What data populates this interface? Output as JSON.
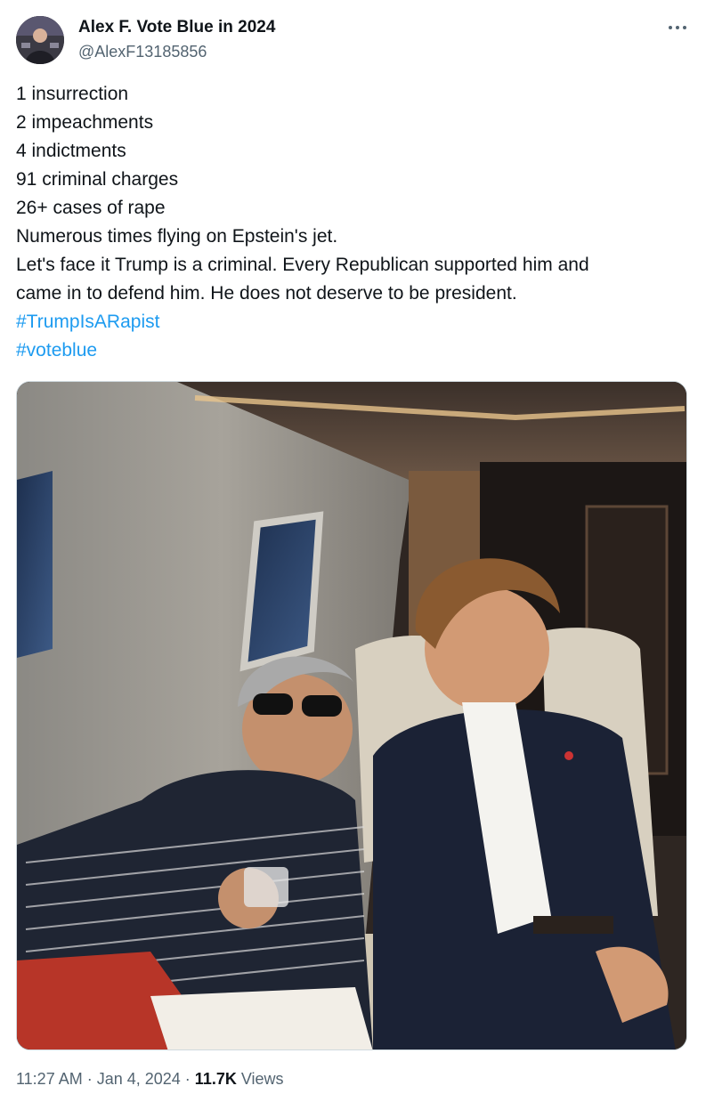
{
  "author": {
    "display_name": "Alex F. Vote Blue in 2024",
    "handle": "@AlexF13185856"
  },
  "tweet": {
    "lines": [
      "1 insurrection",
      "2 impeachments",
      "4 indictments",
      "91 criminal charges",
      "26+ cases of rape",
      "Numerous times flying on Epstein's jet.",
      "Let's face it Trump is a criminal. Every Republican supported him and",
      "came in to defend him. He does not deserve to be president."
    ],
    "hashtags": [
      "#TrumpIsARapist",
      "#voteblue"
    ]
  },
  "meta": {
    "time": "11:27 AM",
    "sep1": " · ",
    "date": "Jan 4, 2024",
    "sep2": " · ",
    "views_count": "11.7K",
    "views_label": " Views"
  },
  "icons": {
    "more": "more-horizontal-icon"
  },
  "colors": {
    "link": "#1d9bf0",
    "secondary_text": "#536471",
    "primary_text": "#0f1419"
  }
}
